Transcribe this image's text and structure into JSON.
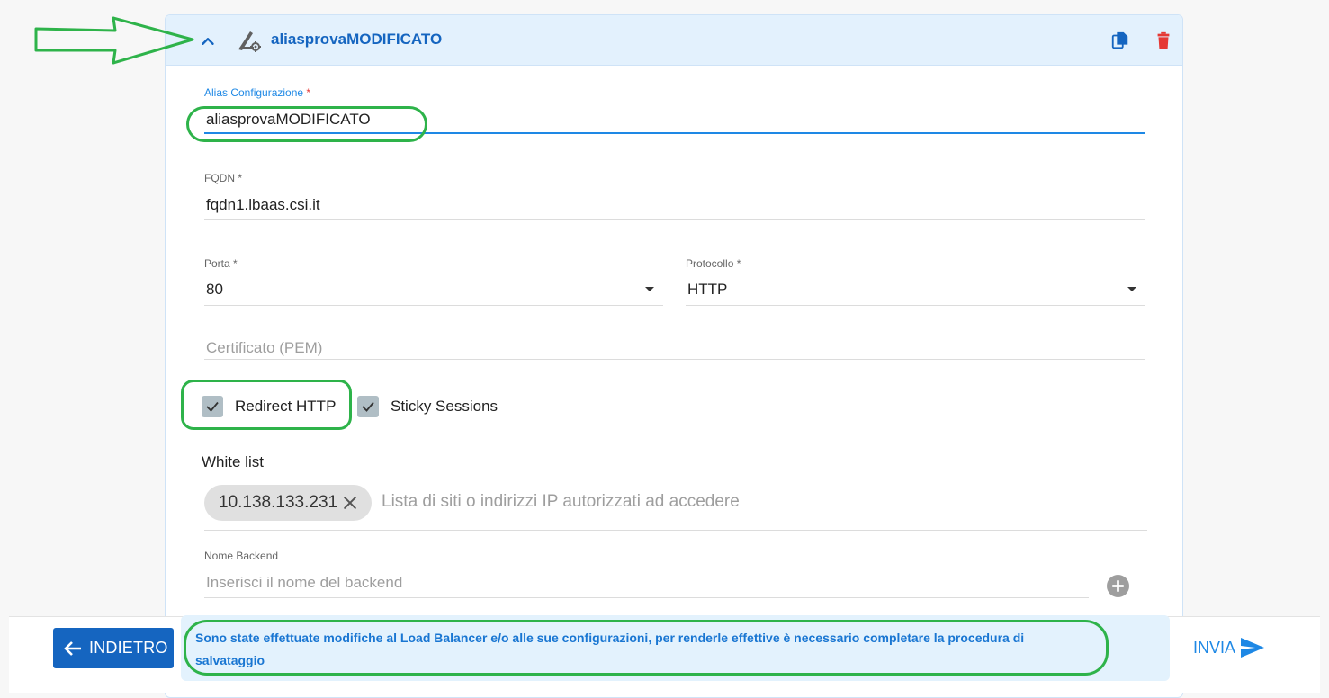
{
  "card": {
    "title": "aliasprovaMODIFICATO"
  },
  "form": {
    "alias": {
      "label": "Alias Configurazione",
      "required_mark": "*",
      "value": "aliasprovaMODIFICATO"
    },
    "fqdn": {
      "label": "FQDN",
      "required_mark": "*",
      "value": "fqdn1.lbaas.csi.it"
    },
    "porta": {
      "label": "Porta",
      "required_mark": "*",
      "value": "80"
    },
    "protocollo": {
      "label": "Protocollo",
      "required_mark": "*",
      "value": "HTTP"
    },
    "certificato": {
      "placeholder": "Certificato (PEM)",
      "value": ""
    },
    "redirect_http": {
      "label": "Redirect HTTP",
      "checked": true
    },
    "sticky_sessions": {
      "label": "Sticky Sessions",
      "checked": true
    },
    "whitelist": {
      "title": "White list",
      "chips": [
        "10.138.133.231"
      ],
      "placeholder": "Lista di siti o indirizzi IP autorizzati ad accedere"
    },
    "backend": {
      "label": "Nome Backend",
      "placeholder": "Inserisci il nome del backend",
      "value": ""
    }
  },
  "footer": {
    "back_label": "INDIETRO",
    "notice": "Sono state effettuate modifiche al Load Balancer e/o alle sue configurazioni, per renderle effettive è necessario completare la procedura di salvataggio",
    "send_label": "INVIA"
  },
  "colors": {
    "primary": "#1565c0",
    "accent": "#1e88e5",
    "danger": "#e53935",
    "annotation": "#2eb34a"
  },
  "icons": {
    "chevron": "chevron-up-icon",
    "config": "settings-config-icon",
    "copy": "copy-icon",
    "delete": "trash-icon",
    "chip_close": "close-icon",
    "add": "add-circle-icon",
    "back": "arrow-left-icon",
    "send": "send-icon"
  }
}
